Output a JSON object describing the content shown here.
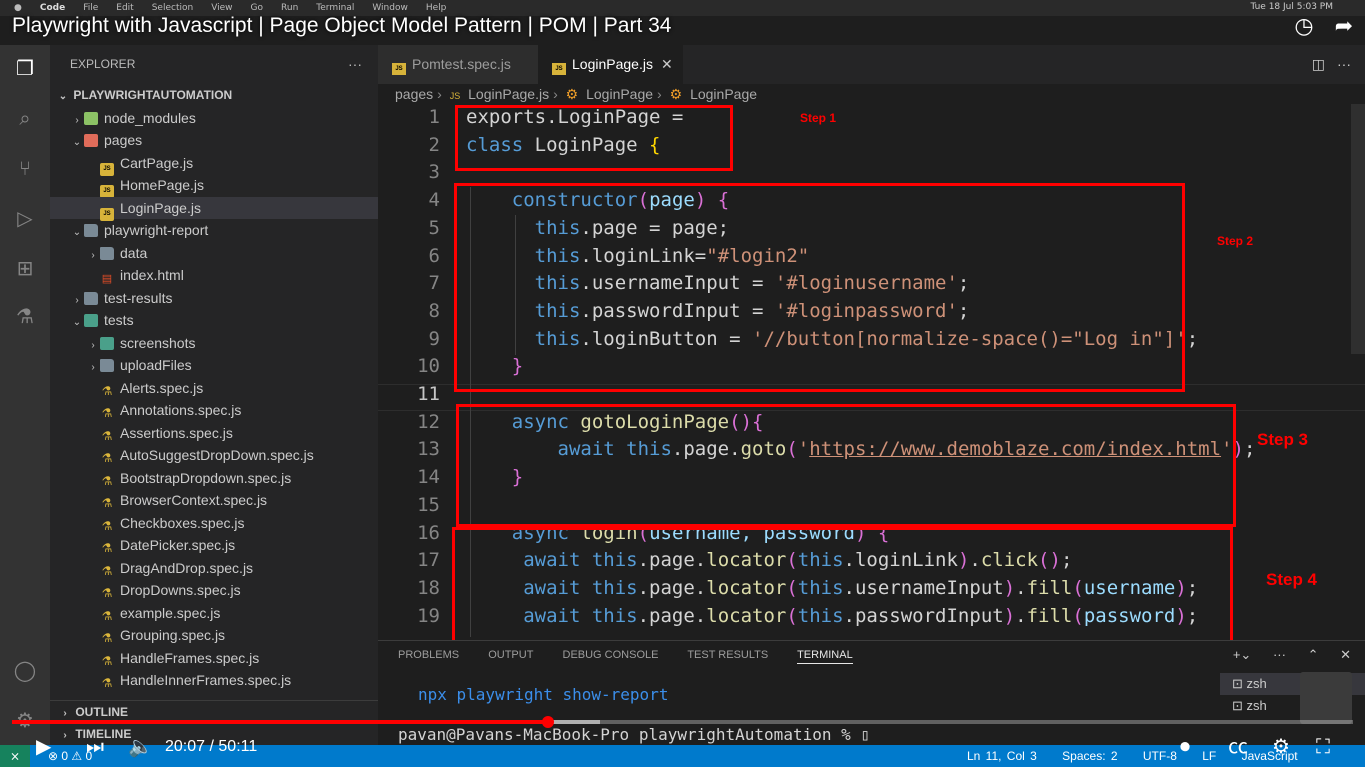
{
  "menubar": {
    "app": "Code",
    "items": [
      "File",
      "Edit",
      "Selection",
      "View",
      "Go",
      "Run",
      "Terminal",
      "Window",
      "Help"
    ],
    "clock": "Tue 18 Jul  5:03 PM"
  },
  "video": {
    "title": "Playwright with Javascript | Page Object Model Pattern | POM | Part 34",
    "current_time": "20:07",
    "duration": "50:11",
    "progress": 0.4
  },
  "explorer": {
    "header": "EXPLORER",
    "more": "···",
    "root": "PLAYWRIGHTAUTOMATION",
    "items": [
      {
        "label": "node_modules",
        "depth": 1,
        "kind": "node",
        "chev": "›"
      },
      {
        "label": "pages",
        "depth": 1,
        "kind": "pages",
        "chev": "⌄"
      },
      {
        "label": "CartPage.js",
        "depth": 2,
        "kind": "js"
      },
      {
        "label": "HomePage.js",
        "depth": 2,
        "kind": "js"
      },
      {
        "label": "LoginPage.js",
        "depth": 2,
        "kind": "js",
        "selected": true
      },
      {
        "label": "playwright-report",
        "depth": 1,
        "kind": "folder",
        "chev": "⌄"
      },
      {
        "label": "data",
        "depth": 2,
        "kind": "folder",
        "chev": "›"
      },
      {
        "label": "index.html",
        "depth": 2,
        "kind": "html"
      },
      {
        "label": "test-results",
        "depth": 1,
        "kind": "folder",
        "chev": "›"
      },
      {
        "label": "tests",
        "depth": 1,
        "kind": "tests",
        "chev": "⌄"
      },
      {
        "label": "screenshots",
        "depth": 2,
        "kind": "tests",
        "chev": "›"
      },
      {
        "label": "uploadFiles",
        "depth": 2,
        "kind": "folder",
        "chev": "›"
      },
      {
        "label": "Alerts.spec.js",
        "depth": 2,
        "kind": "flask"
      },
      {
        "label": "Annotations.spec.js",
        "depth": 2,
        "kind": "flask"
      },
      {
        "label": "Assertions.spec.js",
        "depth": 2,
        "kind": "flask"
      },
      {
        "label": "AutoSuggestDropDown.spec.js",
        "depth": 2,
        "kind": "flask"
      },
      {
        "label": "BootstrapDropdown.spec.js",
        "depth": 2,
        "kind": "flask"
      },
      {
        "label": "BrowserContext.spec.js",
        "depth": 2,
        "kind": "flask"
      },
      {
        "label": "Checkboxes.spec.js",
        "depth": 2,
        "kind": "flask"
      },
      {
        "label": "DatePicker.spec.js",
        "depth": 2,
        "kind": "flask"
      },
      {
        "label": "DragAndDrop.spec.js",
        "depth": 2,
        "kind": "flask"
      },
      {
        "label": "DropDowns.spec.js",
        "depth": 2,
        "kind": "flask"
      },
      {
        "label": "example.spec.js",
        "depth": 2,
        "kind": "flask"
      },
      {
        "label": "Grouping.spec.js",
        "depth": 2,
        "kind": "flask"
      },
      {
        "label": "HandleFrames.spec.js",
        "depth": 2,
        "kind": "flask"
      },
      {
        "label": "HandleInnerFrames.spec.js",
        "depth": 2,
        "kind": "flask"
      }
    ],
    "outline": "OUTLINE",
    "timeline": "TIMELINE"
  },
  "tabs": [
    {
      "label": "Pomtest.spec.js",
      "active": false
    },
    {
      "label": "LoginPage.js",
      "active": true
    }
  ],
  "breadcrumb": [
    "pages",
    "LoginPage.js",
    "LoginPage",
    "LoginPage"
  ],
  "code_lines": [
    {
      "n": "1",
      "parts": [
        [
          "exports.LoginPage =",
          ""
        ]
      ]
    },
    {
      "n": "2",
      "parts": [
        [
          "class ",
          "kw"
        ],
        [
          "LoginPage ",
          ""
        ],
        [
          "{",
          "bry"
        ]
      ]
    },
    {
      "n": "3",
      "parts": []
    },
    {
      "n": "4",
      "parts": [
        [
          "    ",
          ""
        ],
        [
          "constructor",
          "kw"
        ],
        [
          "(",
          "br2"
        ],
        [
          "page",
          "vr"
        ],
        [
          ")",
          "br2"
        ],
        [
          " {",
          "br2"
        ]
      ]
    },
    {
      "n": "5",
      "parts": [
        [
          "      ",
          ""
        ],
        [
          "this",
          "kw"
        ],
        [
          ".page = page;",
          ""
        ]
      ]
    },
    {
      "n": "6",
      "parts": [
        [
          "      ",
          ""
        ],
        [
          "this",
          "kw"
        ],
        [
          ".loginLink=",
          ""
        ],
        [
          "\"#login2\"",
          "str"
        ]
      ]
    },
    {
      "n": "7",
      "parts": [
        [
          "      ",
          ""
        ],
        [
          "this",
          "kw"
        ],
        [
          ".usernameInput = ",
          ""
        ],
        [
          "'#loginusername'",
          "str"
        ],
        [
          ";",
          ""
        ]
      ]
    },
    {
      "n": "8",
      "parts": [
        [
          "      ",
          ""
        ],
        [
          "this",
          "kw"
        ],
        [
          ".passwordInput = ",
          ""
        ],
        [
          "'#loginpassword'",
          "str"
        ],
        [
          ";",
          ""
        ]
      ]
    },
    {
      "n": "9",
      "parts": [
        [
          "      ",
          ""
        ],
        [
          "this",
          "kw"
        ],
        [
          ".loginButton = ",
          ""
        ],
        [
          "'//button[normalize-space()=\"Log in\"]'",
          "str"
        ],
        [
          ";",
          ""
        ]
      ]
    },
    {
      "n": "10",
      "parts": [
        [
          "    ",
          ""
        ],
        [
          "}",
          "br2"
        ]
      ]
    },
    {
      "n": "11",
      "parts": []
    },
    {
      "n": "12",
      "parts": [
        [
          "    ",
          ""
        ],
        [
          "async ",
          "kw"
        ],
        [
          "gotoLoginPage",
          "fn"
        ],
        [
          "()",
          "br2"
        ],
        [
          "{",
          "br2"
        ]
      ]
    },
    {
      "n": "13",
      "parts": [
        [
          "        ",
          ""
        ],
        [
          "await ",
          "kw"
        ],
        [
          "this",
          "kw"
        ],
        [
          ".page.",
          ""
        ],
        [
          "goto",
          "fn"
        ],
        [
          "(",
          "br2"
        ],
        [
          "'",
          "str"
        ],
        [
          "https://www.demoblaze.com/index.html",
          "str url"
        ],
        [
          "'",
          "str"
        ],
        [
          ")",
          "br2"
        ],
        [
          ";",
          ""
        ]
      ]
    },
    {
      "n": "14",
      "parts": [
        [
          "    ",
          ""
        ],
        [
          "}",
          "br2"
        ]
      ]
    },
    {
      "n": "15",
      "parts": []
    },
    {
      "n": "16",
      "parts": [
        [
          "    ",
          ""
        ],
        [
          "async ",
          "kw"
        ],
        [
          "login",
          "fn"
        ],
        [
          "(",
          "br2"
        ],
        [
          "username, password",
          "vr"
        ],
        [
          ")",
          "br2"
        ],
        [
          " {",
          "br2"
        ]
      ]
    },
    {
      "n": "17",
      "parts": [
        [
          "     ",
          ""
        ],
        [
          "await ",
          "kw"
        ],
        [
          "this",
          "kw"
        ],
        [
          ".page.",
          ""
        ],
        [
          "locator",
          "fn"
        ],
        [
          "(",
          "br2"
        ],
        [
          "this",
          "kw"
        ],
        [
          ".loginLink",
          ""
        ],
        [
          ")",
          "br2"
        ],
        [
          ".",
          ""
        ],
        [
          "click",
          "fn"
        ],
        [
          "()",
          "br2"
        ],
        [
          ";",
          ""
        ]
      ]
    },
    {
      "n": "18",
      "parts": [
        [
          "     ",
          ""
        ],
        [
          "await ",
          "kw"
        ],
        [
          "this",
          "kw"
        ],
        [
          ".page.",
          ""
        ],
        [
          "locator",
          "fn"
        ],
        [
          "(",
          "br2"
        ],
        [
          "this",
          "kw"
        ],
        [
          ".usernameInput",
          ""
        ],
        [
          ")",
          "br2"
        ],
        [
          ".",
          ""
        ],
        [
          "fill",
          "fn"
        ],
        [
          "(",
          "br2"
        ],
        [
          "username",
          "vr"
        ],
        [
          ")",
          "br2"
        ],
        [
          ";",
          ""
        ]
      ]
    },
    {
      "n": "19",
      "parts": [
        [
          "     ",
          ""
        ],
        [
          "await ",
          "kw"
        ],
        [
          "this",
          "kw"
        ],
        [
          ".page.",
          ""
        ],
        [
          "locator",
          "fn"
        ],
        [
          "(",
          "br2"
        ],
        [
          "this",
          "kw"
        ],
        [
          ".passwordInput",
          ""
        ],
        [
          ")",
          "br2"
        ],
        [
          ".",
          ""
        ],
        [
          "fill",
          "fn"
        ],
        [
          "(",
          "br2"
        ],
        [
          "password",
          "vr"
        ],
        [
          ")",
          "br2"
        ],
        [
          ";",
          ""
        ]
      ]
    }
  ],
  "annotations": [
    "Step 1",
    "Step 2",
    "Step 3",
    "Step 4"
  ],
  "panel": {
    "tabs": [
      "PROBLEMS",
      "OUTPUT",
      "DEBUG CONSOLE",
      "TEST RESULTS",
      "TERMINAL"
    ],
    "active_tab": "TERMINAL",
    "terminal_lines": [
      "npx playwright show-report",
      "pavan@Pavans-MacBook-Pro playwrightAutomation % "
    ],
    "terminals": [
      "zsh",
      "zsh"
    ]
  },
  "statusbar": {
    "errors": "0",
    "warnings": "0",
    "position": "Ln 11, Col 3",
    "spaces": "Spaces: 2",
    "encoding": "UTF-8",
    "eol": "LF",
    "language": "JavaScript"
  },
  "colors": {
    "activity": "#333333",
    "sidebar": "#252526",
    "editor": "#1e1e1e",
    "status": "#007acc",
    "annotation": "#ff0000"
  }
}
